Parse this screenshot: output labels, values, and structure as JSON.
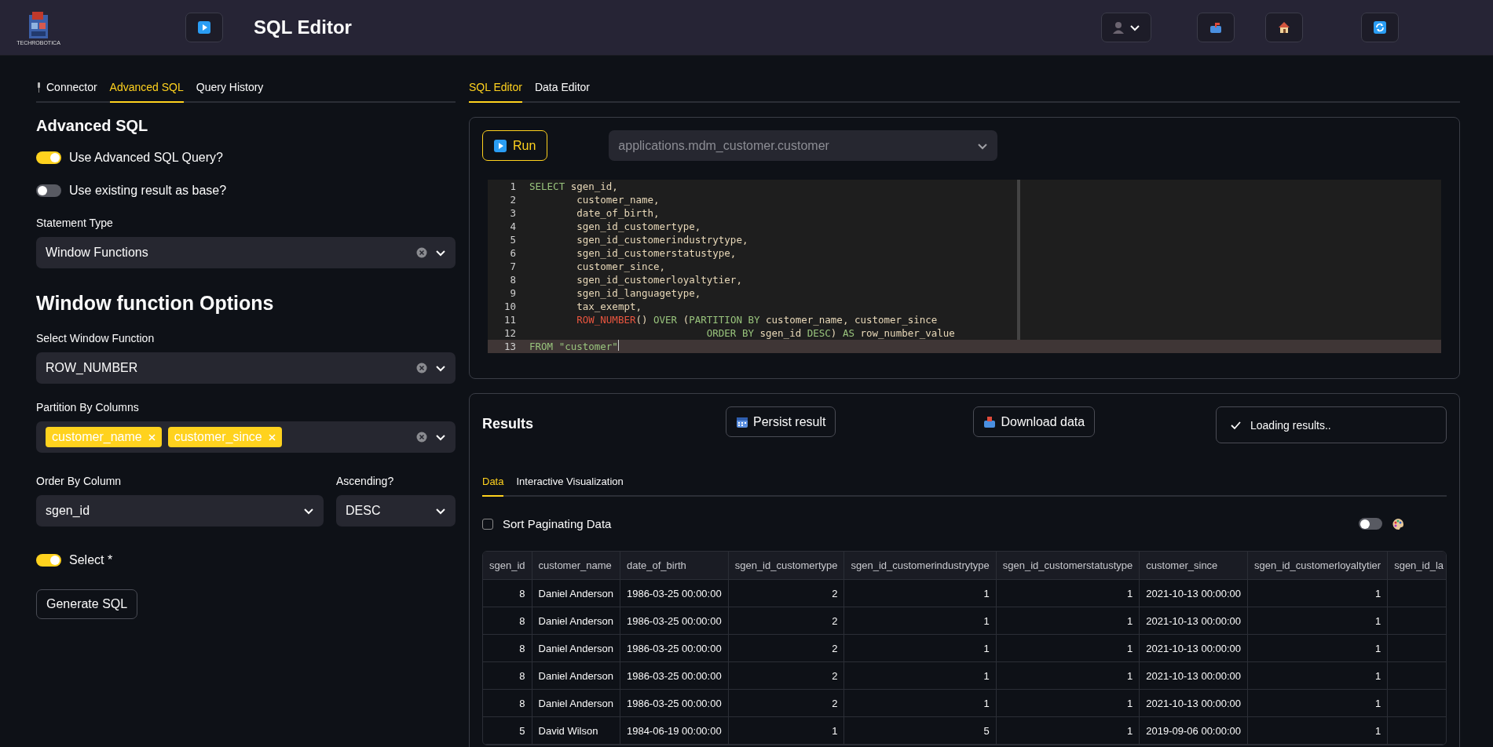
{
  "header": {
    "logo_text": "TECHROBOTICA",
    "title": "SQL Editor"
  },
  "left_tabs": [
    {
      "label": "Connector",
      "selected": false,
      "icon": true
    },
    {
      "label": "Advanced SQL",
      "selected": true
    },
    {
      "label": "Query History",
      "selected": false
    }
  ],
  "advanced": {
    "heading": "Advanced SQL",
    "toggles": [
      {
        "label": "Use Advanced SQL Query?",
        "on": true
      },
      {
        "label": "Use existing result as base?",
        "on": false
      }
    ],
    "statement_type": {
      "label": "Statement Type",
      "value": "Window Functions"
    }
  },
  "window_options": {
    "heading": "Window function Options",
    "function": {
      "label": "Select Window Function",
      "value": "ROW_NUMBER"
    },
    "partition": {
      "label": "Partition By Columns",
      "chips": [
        "customer_name",
        "customer_since"
      ]
    },
    "order_by": {
      "label": "Order By Column",
      "value": "sgen_id"
    },
    "ascending": {
      "label": "Ascending?",
      "value": "DESC"
    },
    "select_all": {
      "label": "Select *",
      "on": true
    },
    "generate_button": "Generate SQL"
  },
  "right_tabs": [
    {
      "label": "SQL Editor",
      "selected": true
    },
    {
      "label": "Data Editor",
      "selected": false
    }
  ],
  "editor": {
    "run_button": "Run",
    "table_select": {
      "placeholder": "applications.mdm_customer.customer"
    },
    "lines": [
      {
        "number": "1",
        "current": false,
        "kind": "statement",
        "tokens": [
          {
            "kind": "keyword",
            "text": "SELECT"
          },
          {
            "kind": "ident",
            "text": " sgen_id,"
          }
        ]
      },
      {
        "number": "2",
        "current": false,
        "kind": "body",
        "tokens": [
          {
            "kind": "ident",
            "text": "customer_name,"
          }
        ]
      },
      {
        "number": "3",
        "current": false,
        "kind": "body",
        "tokens": [
          {
            "kind": "ident",
            "text": "date_of_birth,"
          }
        ]
      },
      {
        "number": "4",
        "current": false,
        "kind": "body",
        "tokens": [
          {
            "kind": "ident",
            "text": "sgen_id_customertype,"
          }
        ]
      },
      {
        "number": "5",
        "current": false,
        "kind": "body",
        "tokens": [
          {
            "kind": "ident",
            "text": "sgen_id_customerindustrytype,"
          }
        ]
      },
      {
        "number": "6",
        "current": false,
        "kind": "body",
        "tokens": [
          {
            "kind": "ident",
            "text": "sgen_id_customerstatustype,"
          }
        ]
      },
      {
        "number": "7",
        "current": false,
        "kind": "body",
        "tokens": [
          {
            "kind": "ident",
            "text": "customer_since,"
          }
        ]
      },
      {
        "number": "8",
        "current": false,
        "kind": "body",
        "tokens": [
          {
            "kind": "ident",
            "text": "sgen_id_customerloyaltytier,"
          }
        ]
      },
      {
        "number": "9",
        "current": false,
        "kind": "body",
        "tokens": [
          {
            "kind": "ident",
            "text": "sgen_id_languagetype,"
          }
        ]
      },
      {
        "number": "10",
        "current": false,
        "kind": "body",
        "tokens": [
          {
            "kind": "ident",
            "text": "tax_exempt,"
          }
        ]
      },
      {
        "number": "11",
        "current": false,
        "kind": "body",
        "tokens": [
          {
            "kind": "function",
            "text": "ROW_NUMBER"
          },
          {
            "kind": "ident",
            "text": "() "
          },
          {
            "kind": "keyword",
            "text": "OVER"
          },
          {
            "kind": "ident",
            "text": " ("
          },
          {
            "kind": "keyword",
            "text": "PARTITION BY"
          },
          {
            "kind": "ident",
            "text": " customer_name, customer_since"
          }
        ]
      },
      {
        "number": "12",
        "current": false,
        "kind": "wrap",
        "tokens": [
          {
            "kind": "keyword",
            "text": "ORDER BY"
          },
          {
            "kind": "ident",
            "text": " sgen_id "
          },
          {
            "kind": "keyword",
            "text": "DESC"
          },
          {
            "kind": "ident",
            "text": ") "
          },
          {
            "kind": "keyword",
            "text": "AS"
          },
          {
            "kind": "ident",
            "text": " row_number_value"
          }
        ]
      },
      {
        "number": "13",
        "current": true,
        "kind": "statement",
        "tokens": [
          {
            "kind": "keyword",
            "text": "FROM"
          },
          {
            "kind": "string",
            "text": " \"customer\""
          }
        ]
      }
    ]
  },
  "results": {
    "heading": "Results",
    "persist_button": "Persist result",
    "download_button": "Download data",
    "status": "Loading results..",
    "tabs": [
      {
        "label": "Data",
        "selected": true
      },
      {
        "label": "Interactive Visualization",
        "selected": false
      }
    ],
    "sort_checkbox": {
      "label": "Sort Paginating Data",
      "checked": false
    },
    "color_toggle": {
      "on": false
    },
    "table": {
      "columns": [
        {
          "label": "sgen_id",
          "kind": "number"
        },
        {
          "label": "customer_name",
          "kind": "text"
        },
        {
          "label": "date_of_birth",
          "kind": "text"
        },
        {
          "label": "sgen_id_customertype",
          "kind": "number"
        },
        {
          "label": "sgen_id_customerindustrytype",
          "kind": "number"
        },
        {
          "label": "sgen_id_customerstatustype",
          "kind": "number"
        },
        {
          "label": "customer_since",
          "kind": "text"
        },
        {
          "label": "sgen_id_customerloyaltytier",
          "kind": "number"
        },
        {
          "label": "sgen_id_la",
          "kind": "number"
        }
      ],
      "rows": [
        [
          "8",
          "Daniel Anderson",
          "1986-03-25 00:00:00",
          "2",
          "1",
          "1",
          "2021-10-13 00:00:00",
          "1"
        ],
        [
          "8",
          "Daniel Anderson",
          "1986-03-25 00:00:00",
          "2",
          "1",
          "1",
          "2021-10-13 00:00:00",
          "1"
        ],
        [
          "8",
          "Daniel Anderson",
          "1986-03-25 00:00:00",
          "2",
          "1",
          "1",
          "2021-10-13 00:00:00",
          "1"
        ],
        [
          "8",
          "Daniel Anderson",
          "1986-03-25 00:00:00",
          "2",
          "1",
          "1",
          "2021-10-13 00:00:00",
          "1"
        ],
        [
          "8",
          "Daniel Anderson",
          "1986-03-25 00:00:00",
          "2",
          "1",
          "1",
          "2021-10-13 00:00:00",
          "1"
        ],
        [
          "5",
          "David Wilson",
          "1984-06-19 00:00:00",
          "1",
          "5",
          "1",
          "2019-09-06 00:00:00",
          "1"
        ]
      ]
    }
  }
}
